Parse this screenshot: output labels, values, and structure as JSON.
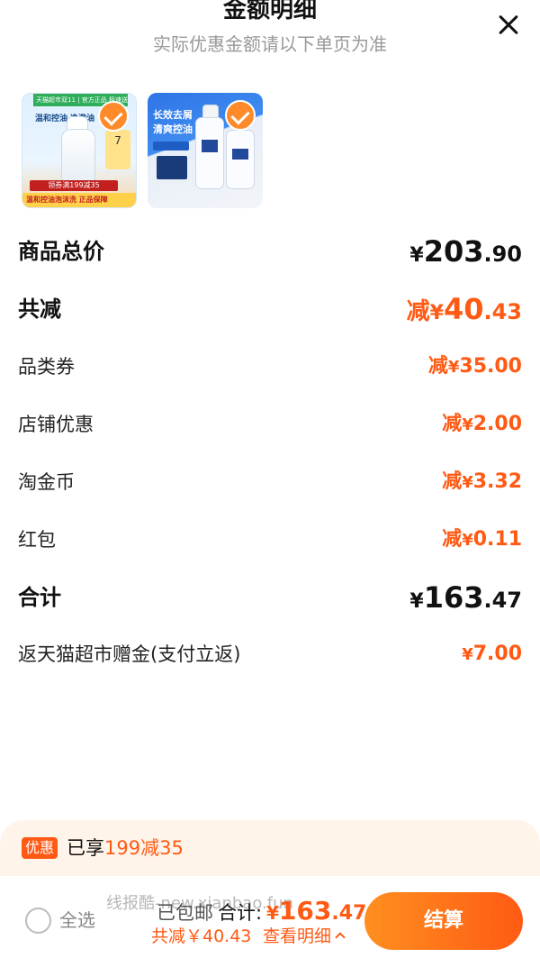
{
  "header": {
    "title": "金额明细",
    "subtitle": "实际优惠金额请以下单页为准"
  },
  "products": [
    {
      "top_banner": "天猫超市双11 | 官方正品 极速送达",
      "headline": "温和控油 净澈油",
      "tag": "7",
      "offer": "领券满199减35",
      "strip": "温和控油泡沫洗 正品保障"
    },
    {
      "headline_line1": "长效去屑",
      "headline_line2": "清爽控油"
    }
  ],
  "breakdown": {
    "subtotal": {
      "label": "商品总价",
      "currency": "¥",
      "integer": "203",
      "decimal": ".90"
    },
    "total_discount": {
      "label": "共减",
      "prefix": "减",
      "currency": "¥",
      "integer": "40",
      "decimal": ".43"
    },
    "items": [
      {
        "label": "品类券",
        "prefix": "减",
        "currency": "¥",
        "amount": "35.00"
      },
      {
        "label": "店铺优惠",
        "prefix": "减",
        "currency": "¥",
        "amount": "2.00"
      },
      {
        "label": "淘金币",
        "prefix": "减",
        "currency": "¥",
        "amount": "3.32"
      },
      {
        "label": "红包",
        "prefix": "减",
        "currency": "¥",
        "amount": "0.11"
      }
    ],
    "total": {
      "label": "合计",
      "currency": "¥",
      "integer": "163",
      "decimal": ".47"
    },
    "rebate": {
      "label": "返天猫超市赠金(支付立返)",
      "currency": "¥",
      "amount": "7.00"
    }
  },
  "promo": {
    "badge": "优惠",
    "text": "已享",
    "highlight": "199减35"
  },
  "footer": {
    "select_all": "全选",
    "watermark": "线报酷-new.xianbao.fun",
    "shipping": "已包邮",
    "total_label": "合计:",
    "total_currency": "¥",
    "total_integer": "163",
    "total_decimal": ".47",
    "savings": "共减￥40.43",
    "detail_link": "查看明细",
    "checkout": "结算"
  },
  "colors": {
    "accent": "#ff5a14",
    "checkout_gradient_start": "#ff8f1f",
    "promo_background": "#fff4ea"
  },
  "icons": {
    "close": "close-icon",
    "selected": "check-icon",
    "expand": "chevron-up-icon"
  }
}
